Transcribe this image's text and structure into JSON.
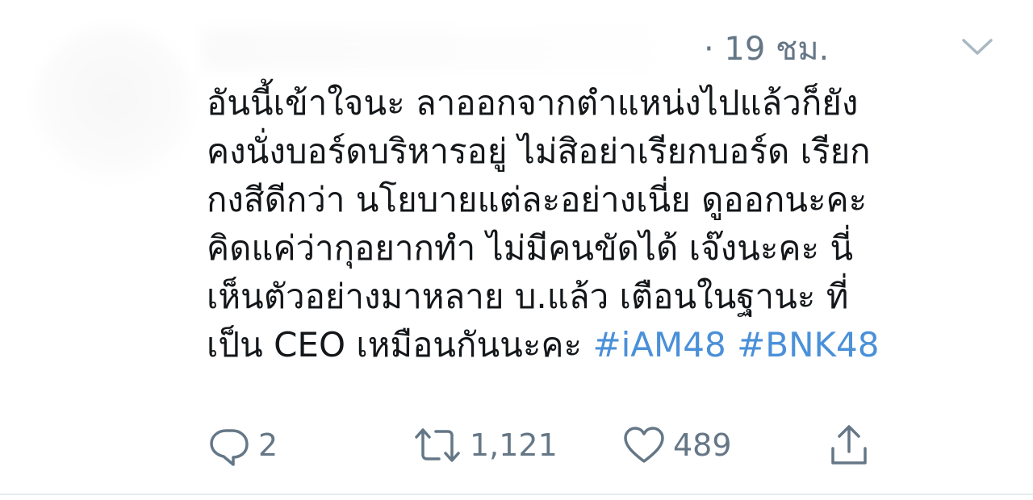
{
  "tweet": {
    "timestamp": "· 19 ชม.",
    "text_lines": [
      "อันนี้เข้าใจนะ ลาออกจากตำแหน่งไปแล้วก็ยัง",
      "คงนั่งบอร์ดบริหารอยู่ ไม่สิอย่าเรียกบอร์ด เรียก",
      "กงสีดีกว่า นโยบายแต่ละอย่างเนี่ย ดูออกนะคะ",
      "คิดแค่ว่ากุอยากทำ ไม่มีคนขัดได้ เจ๊งนะคะ นี่",
      "เห็นตัวอย่างมาหลาย บ.แล้ว เตือนในฐานะ ที่"
    ],
    "last_line_text": "เป็น CEO เหมือนกันนะคะ ",
    "hashtags": [
      "#iAM48",
      "#BNK48"
    ]
  },
  "actions": {
    "reply_count": "2",
    "retweet_count": "1,121",
    "like_count": "489"
  },
  "colors": {
    "text": "#14171a",
    "secondary": "#657786",
    "link": "#4a90d9",
    "divider": "#e6ecf0"
  },
  "icons": {
    "caret": "chevron-down-icon",
    "reply": "reply-icon",
    "retweet": "retweet-icon",
    "like": "heart-icon",
    "share": "share-icon"
  }
}
